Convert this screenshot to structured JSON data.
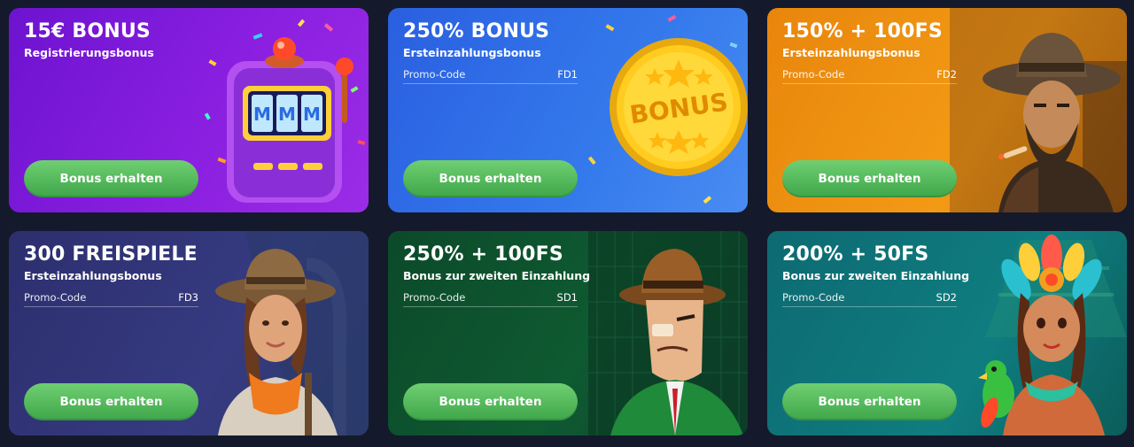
{
  "cards": [
    {
      "title": "15€ BONUS",
      "subtitle": "Registrierungsbonus",
      "button": "Bonus erhalten",
      "art": "slot-machine-icon"
    },
    {
      "title": "250% BONUS",
      "subtitle": "Ersteinzahlungsbonus",
      "promo_label": "Promo-Code",
      "promo_code": "FD1",
      "button": "Bonus erhalten",
      "art": "bonus-coin-icon"
    },
    {
      "title": "150% + 100FS",
      "subtitle": "Ersteinzahlungsbonus",
      "promo_label": "Promo-Code",
      "promo_code": "FD2",
      "button": "Bonus erhalten",
      "art": "cowboy-character"
    },
    {
      "title": "300 FREISPIELE",
      "subtitle": "Ersteinzahlungsbonus",
      "promo_label": "Promo-Code",
      "promo_code": "FD3",
      "button": "Bonus erhalten",
      "art": "explorer-woman-character"
    },
    {
      "title": "250% + 100FS",
      "subtitle": "Bonus zur zweiten Einzahlung",
      "promo_label": "Promo-Code",
      "promo_code": "SD1",
      "button": "Bonus erhalten",
      "art": "detective-character"
    },
    {
      "title": "200% + 50FS",
      "subtitle": "Bonus zur zweiten Einzahlung",
      "promo_label": "Promo-Code",
      "promo_code": "SD2",
      "button": "Bonus erhalten",
      "art": "aztec-woman-character"
    }
  ],
  "slot_reel_symbol": "M",
  "coin_text": "BONUS",
  "colors": {
    "page_bg": "#141a2b",
    "button": "#4fb85a",
    "card1": "#7a17d8",
    "card2": "#2f6ee6",
    "card3": "#ef9212",
    "card4": "#31357a",
    "card5": "#0e5230",
    "card6": "#0e7478"
  }
}
